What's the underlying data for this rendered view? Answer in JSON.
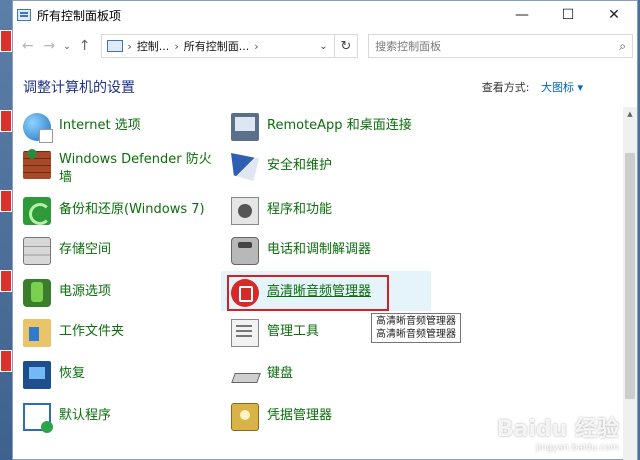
{
  "window": {
    "title": "所有控制面板项",
    "minimize": "—",
    "maximize": "☐",
    "close": "✕"
  },
  "nav": {
    "back": "←",
    "forward": "→",
    "dropdown": "⌄",
    "up": "↑",
    "breadcrumb": [
      "控制...",
      "所有控制面...",
      "›"
    ],
    "refresh": "↻",
    "search_placeholder": "搜索控制面板",
    "search_icon": "search-icon"
  },
  "header": {
    "title": "调整计算机的设置",
    "view_by_label": "查看方式:",
    "view_by_value": "大图标 ▾"
  },
  "items_col1": [
    {
      "label": "Internet 选项",
      "icon": "internet-options-icon"
    },
    {
      "label": "Windows Defender 防火墙",
      "icon": "firewall-icon"
    },
    {
      "label": "备份和还原(Windows 7)",
      "icon": "backup-icon"
    },
    {
      "label": "存储空间",
      "icon": "storage-icon"
    },
    {
      "label": "电源选项",
      "icon": "power-icon"
    },
    {
      "label": "工作文件夹",
      "icon": "work-folders-icon"
    },
    {
      "label": "恢复",
      "icon": "recovery-icon"
    },
    {
      "label": "默认程序",
      "icon": "default-programs-icon"
    }
  ],
  "items_col2": [
    {
      "label": "RemoteApp 和桌面连接",
      "icon": "remoteapp-icon"
    },
    {
      "label": "安全和维护",
      "icon": "security-flag-icon"
    },
    {
      "label": "程序和功能",
      "icon": "programs-icon"
    },
    {
      "label": "电话和调制解调器",
      "icon": "phone-modem-icon"
    },
    {
      "label": "高清晰音频管理器",
      "icon": "audio-manager-icon"
    },
    {
      "label": "管理工具",
      "icon": "admin-tools-icon"
    },
    {
      "label": "键盘",
      "icon": "keyboard-icon"
    },
    {
      "label": "凭据管理器",
      "icon": "credential-icon"
    }
  ],
  "tooltip": {
    "line1": "高清晰音频管理器",
    "line2": "高清晰音频管理器"
  },
  "watermark": {
    "text": "Baidu 经验",
    "sub": "jingyan.baidu.com"
  },
  "colors": {
    "link_green": "#0b6d0b",
    "heading_blue": "#1e3287",
    "highlight_red": "#d42222"
  }
}
